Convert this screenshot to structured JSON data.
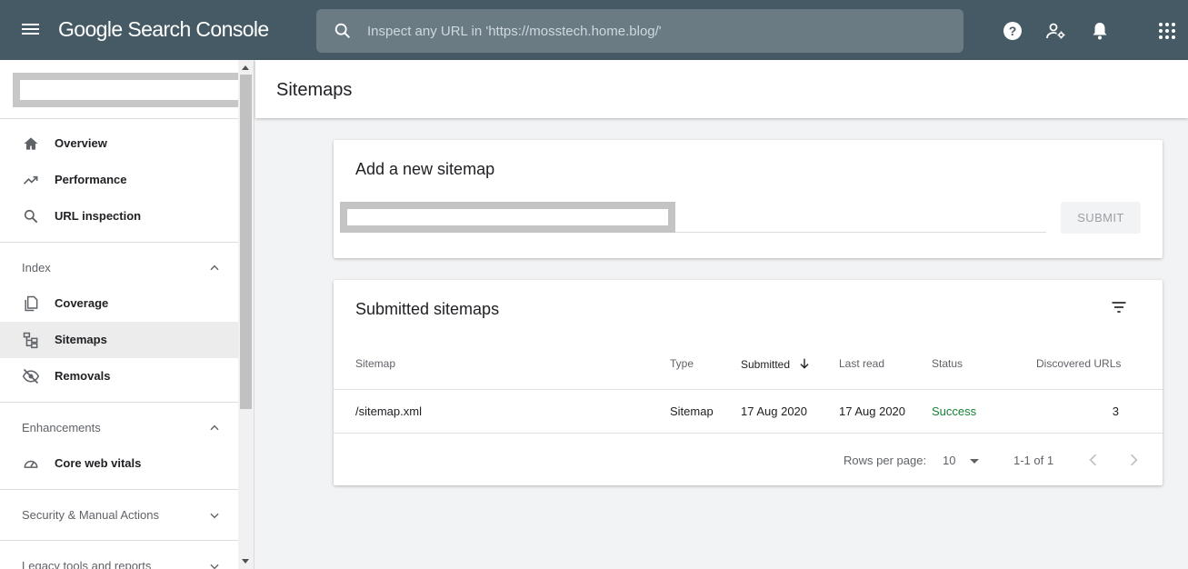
{
  "topbar": {
    "brand": "Google Search Console",
    "search_placeholder": "Inspect any URL in 'https://mosstech.home.blog/'"
  },
  "sidebar": {
    "main_items": [
      {
        "label": "Overview",
        "icon": "home-icon"
      },
      {
        "label": "Performance",
        "icon": "trending-icon"
      },
      {
        "label": "URL inspection",
        "icon": "search-icon"
      }
    ],
    "index": {
      "label": "Index",
      "items": [
        {
          "label": "Coverage",
          "icon": "coverage-icon"
        },
        {
          "label": "Sitemaps",
          "icon": "sitemap-icon",
          "active": true
        },
        {
          "label": "Removals",
          "icon": "eye-off-icon"
        }
      ]
    },
    "enhancements": {
      "label": "Enhancements",
      "items": [
        {
          "label": "Core web vitals",
          "icon": "gauge-icon"
        }
      ]
    },
    "security_label": "Security & Manual Actions",
    "legacy_label": "Legacy tools and reports"
  },
  "page": {
    "title": "Sitemaps"
  },
  "add_sitemap": {
    "heading": "Add a new sitemap",
    "submit_label": "SUBMIT"
  },
  "submitted": {
    "heading": "Submitted sitemaps",
    "columns": {
      "sitemap": "Sitemap",
      "type": "Type",
      "submitted": "Submitted",
      "last_read": "Last read",
      "status": "Status",
      "discovered": "Discovered URLs"
    },
    "rows": [
      {
        "sitemap": "/sitemap.xml",
        "type": "Sitemap",
        "submitted": "17 Aug 2020",
        "last_read": "17 Aug 2020",
        "status": "Success",
        "discovered": "3"
      }
    ],
    "pager": {
      "rows_per_page_label": "Rows per page:",
      "rows_per_page": "10",
      "range": "1-1 of 1"
    }
  },
  "colors": {
    "topbar": "#455a64",
    "success": "#188038",
    "active_item": "#ececec"
  }
}
